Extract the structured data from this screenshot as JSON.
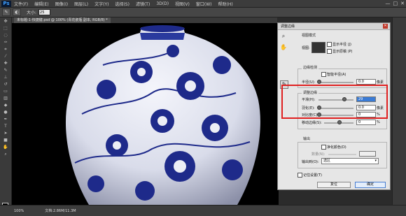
{
  "app": {
    "logo": "Ps"
  },
  "menubar": {
    "items": [
      "文件(F)",
      "编辑(E)",
      "图像(I)",
      "图层(L)",
      "文字(Y)",
      "选择(S)",
      "滤镜(T)",
      "3D(D)",
      "视图(V)",
      "窗口(W)",
      "帮助(H)"
    ],
    "window_controls": [
      "—",
      "□",
      "✕"
    ]
  },
  "options_bar": {
    "size_label": "大小:",
    "size_value": "25"
  },
  "document": {
    "tab_title": "未标题-1-快捷键.psd @ 100% (青花瓷瓶 副本, RGB/8) *"
  },
  "statusbar": {
    "zoom": "100%",
    "doc_info": "文档:2.86M/11.3M"
  },
  "dialog": {
    "title": "调整边缘",
    "view_mode": {
      "section": "视图模式",
      "view_label": "视图:",
      "show_radius": "显示半径 (J)",
      "show_original": "显示原稿 (P)"
    },
    "edge_detection": {
      "section": "边缘检测",
      "smart_radius": "智能半径(A)",
      "radius_label": "半径(U):",
      "radius_value": "0.0",
      "radius_unit": "像素"
    },
    "adjust_edge": {
      "section": "调整边缘",
      "smooth_label": "平滑(H):",
      "smooth_value": "29",
      "feather_label": "羽化(E):",
      "feather_value": "0.0",
      "feather_unit": "像素",
      "contrast_label": "对比度(C):",
      "contrast_value": "0",
      "contrast_unit": "%",
      "shift_label": "移动边缘(S):",
      "shift_value": "0",
      "shift_unit": "%"
    },
    "output": {
      "section": "输出",
      "decontaminate": "净化颜色(D)",
      "amount_label": "数量(N):",
      "output_to_label": "输出到(O):",
      "output_to_value": "选区"
    },
    "remember": "记住设置(T)",
    "cancel": "复位",
    "ok": "确定"
  },
  "colors": {
    "highlight": "#e02020",
    "vase_blue": "#1e2a8a",
    "vase_white": "#eceef5"
  }
}
